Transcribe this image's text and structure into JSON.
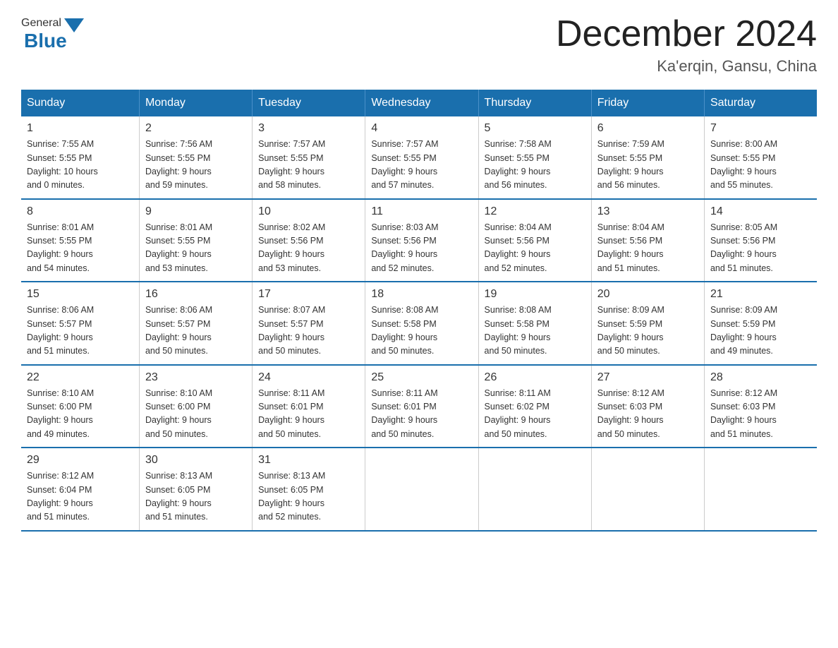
{
  "header": {
    "logo_general": "General",
    "logo_blue": "Blue",
    "month_title": "December 2024",
    "location": "Ka'erqin, Gansu, China"
  },
  "days_of_week": [
    "Sunday",
    "Monday",
    "Tuesday",
    "Wednesday",
    "Thursday",
    "Friday",
    "Saturday"
  ],
  "weeks": [
    [
      {
        "day": "1",
        "sunrise": "7:55 AM",
        "sunset": "5:55 PM",
        "daylight": "10 hours and 0 minutes."
      },
      {
        "day": "2",
        "sunrise": "7:56 AM",
        "sunset": "5:55 PM",
        "daylight": "9 hours and 59 minutes."
      },
      {
        "day": "3",
        "sunrise": "7:57 AM",
        "sunset": "5:55 PM",
        "daylight": "9 hours and 58 minutes."
      },
      {
        "day": "4",
        "sunrise": "7:57 AM",
        "sunset": "5:55 PM",
        "daylight": "9 hours and 57 minutes."
      },
      {
        "day": "5",
        "sunrise": "7:58 AM",
        "sunset": "5:55 PM",
        "daylight": "9 hours and 56 minutes."
      },
      {
        "day": "6",
        "sunrise": "7:59 AM",
        "sunset": "5:55 PM",
        "daylight": "9 hours and 56 minutes."
      },
      {
        "day": "7",
        "sunrise": "8:00 AM",
        "sunset": "5:55 PM",
        "daylight": "9 hours and 55 minutes."
      }
    ],
    [
      {
        "day": "8",
        "sunrise": "8:01 AM",
        "sunset": "5:55 PM",
        "daylight": "9 hours and 54 minutes."
      },
      {
        "day": "9",
        "sunrise": "8:01 AM",
        "sunset": "5:55 PM",
        "daylight": "9 hours and 53 minutes."
      },
      {
        "day": "10",
        "sunrise": "8:02 AM",
        "sunset": "5:56 PM",
        "daylight": "9 hours and 53 minutes."
      },
      {
        "day": "11",
        "sunrise": "8:03 AM",
        "sunset": "5:56 PM",
        "daylight": "9 hours and 52 minutes."
      },
      {
        "day": "12",
        "sunrise": "8:04 AM",
        "sunset": "5:56 PM",
        "daylight": "9 hours and 52 minutes."
      },
      {
        "day": "13",
        "sunrise": "8:04 AM",
        "sunset": "5:56 PM",
        "daylight": "9 hours and 51 minutes."
      },
      {
        "day": "14",
        "sunrise": "8:05 AM",
        "sunset": "5:56 PM",
        "daylight": "9 hours and 51 minutes."
      }
    ],
    [
      {
        "day": "15",
        "sunrise": "8:06 AM",
        "sunset": "5:57 PM",
        "daylight": "9 hours and 51 minutes."
      },
      {
        "day": "16",
        "sunrise": "8:06 AM",
        "sunset": "5:57 PM",
        "daylight": "9 hours and 50 minutes."
      },
      {
        "day": "17",
        "sunrise": "8:07 AM",
        "sunset": "5:57 PM",
        "daylight": "9 hours and 50 minutes."
      },
      {
        "day": "18",
        "sunrise": "8:08 AM",
        "sunset": "5:58 PM",
        "daylight": "9 hours and 50 minutes."
      },
      {
        "day": "19",
        "sunrise": "8:08 AM",
        "sunset": "5:58 PM",
        "daylight": "9 hours and 50 minutes."
      },
      {
        "day": "20",
        "sunrise": "8:09 AM",
        "sunset": "5:59 PM",
        "daylight": "9 hours and 50 minutes."
      },
      {
        "day": "21",
        "sunrise": "8:09 AM",
        "sunset": "5:59 PM",
        "daylight": "9 hours and 49 minutes."
      }
    ],
    [
      {
        "day": "22",
        "sunrise": "8:10 AM",
        "sunset": "6:00 PM",
        "daylight": "9 hours and 49 minutes."
      },
      {
        "day": "23",
        "sunrise": "8:10 AM",
        "sunset": "6:00 PM",
        "daylight": "9 hours and 50 minutes."
      },
      {
        "day": "24",
        "sunrise": "8:11 AM",
        "sunset": "6:01 PM",
        "daylight": "9 hours and 50 minutes."
      },
      {
        "day": "25",
        "sunrise": "8:11 AM",
        "sunset": "6:01 PM",
        "daylight": "9 hours and 50 minutes."
      },
      {
        "day": "26",
        "sunrise": "8:11 AM",
        "sunset": "6:02 PM",
        "daylight": "9 hours and 50 minutes."
      },
      {
        "day": "27",
        "sunrise": "8:12 AM",
        "sunset": "6:03 PM",
        "daylight": "9 hours and 50 minutes."
      },
      {
        "day": "28",
        "sunrise": "8:12 AM",
        "sunset": "6:03 PM",
        "daylight": "9 hours and 51 minutes."
      }
    ],
    [
      {
        "day": "29",
        "sunrise": "8:12 AM",
        "sunset": "6:04 PM",
        "daylight": "9 hours and 51 minutes."
      },
      {
        "day": "30",
        "sunrise": "8:13 AM",
        "sunset": "6:05 PM",
        "daylight": "9 hours and 51 minutes."
      },
      {
        "day": "31",
        "sunrise": "8:13 AM",
        "sunset": "6:05 PM",
        "daylight": "9 hours and 52 minutes."
      },
      null,
      null,
      null,
      null
    ]
  ],
  "labels": {
    "sunrise_prefix": "Sunrise: ",
    "sunset_prefix": "Sunset: ",
    "daylight_prefix": "Daylight: "
  }
}
